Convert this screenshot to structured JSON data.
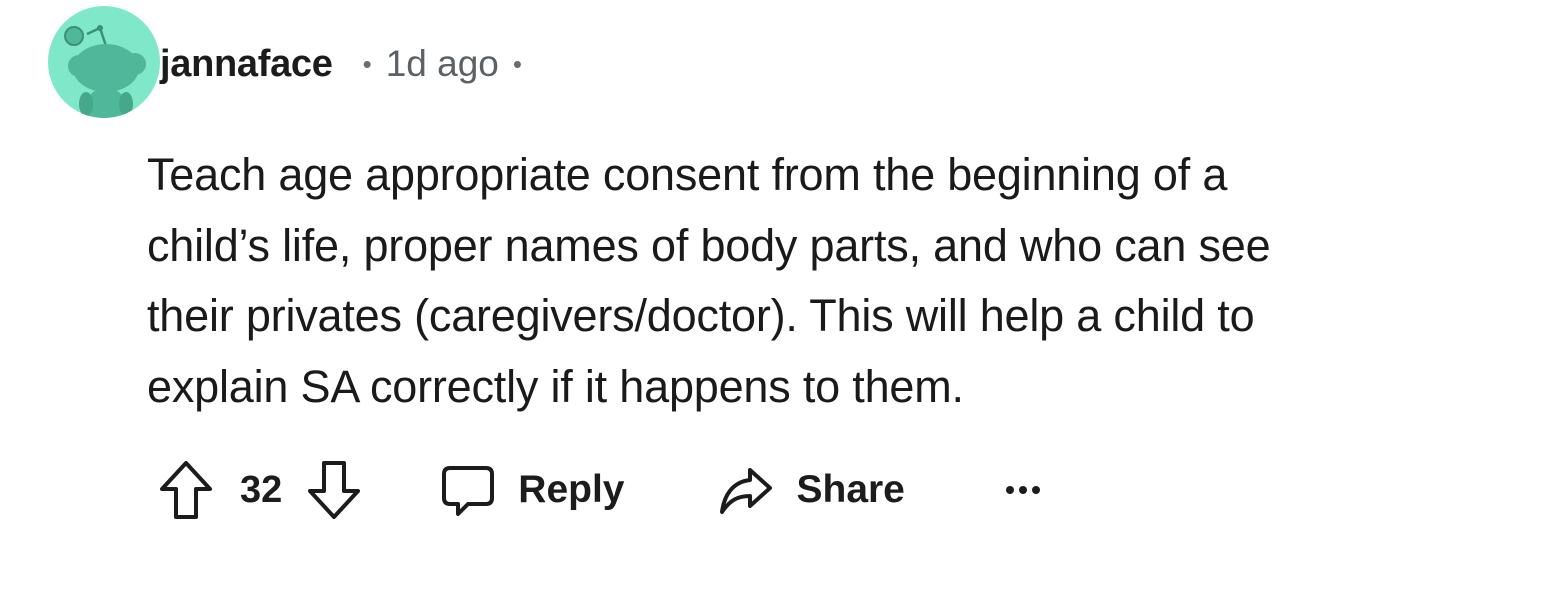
{
  "comment": {
    "username": "jannaface",
    "separator": "•",
    "timestamp": "1d ago",
    "body_lines": [
      "Teach age appropriate consent from the beginning of a",
      "child’s life, proper names of body parts, and who can see",
      "their privates (caregivers/doctor). This will help a child to",
      "explain SA correctly if it happens to them."
    ]
  },
  "actions": {
    "upvote_icon": "arrow-up-outline-icon",
    "vote_count": "32",
    "downvote_icon": "arrow-down-outline-icon",
    "reply_icon": "speech-bubble-icon",
    "reply_label": "Reply",
    "share_icon": "share-arrow-icon",
    "share_label": "Share",
    "more_icon": "ellipsis-icon"
  },
  "colors": {
    "avatar_bg": "#7ee8c9",
    "avatar_figure": "#4fb89a",
    "text_primary": "#1a1a1b",
    "text_meta": "#5c6166"
  }
}
